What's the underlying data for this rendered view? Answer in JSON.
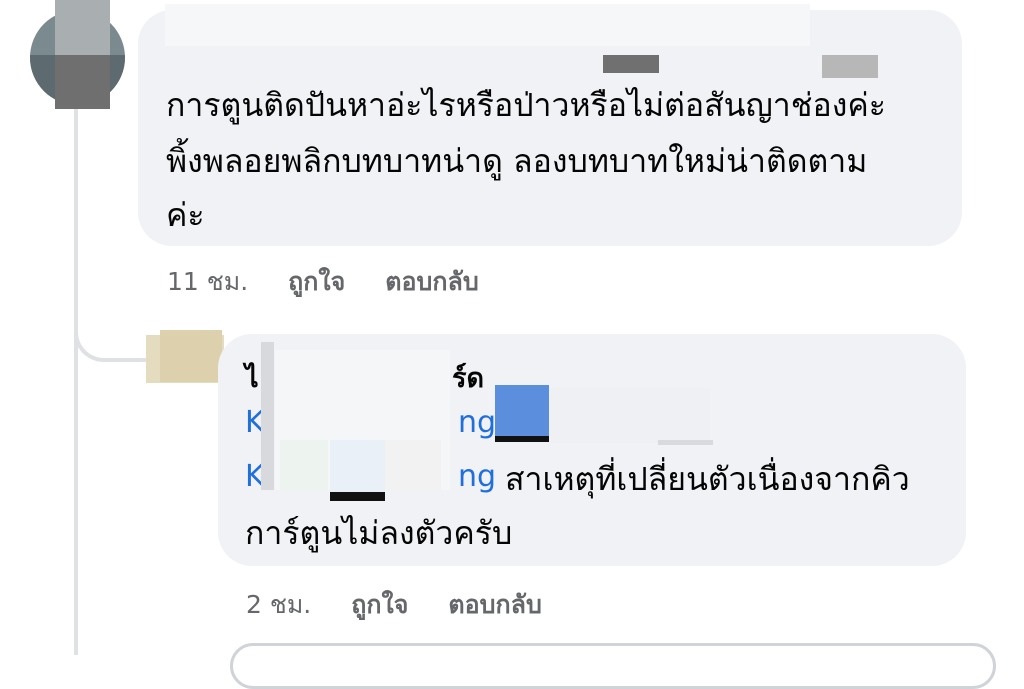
{
  "comment": {
    "author_visible": "",
    "text_line1": "การตูนติดปันหาอ่ะไรหรือป่าวหรือไม่ต่อสันญาช่องค่ะ",
    "text_line2": "พิ้งพลอยพลิกบทบาทน่าดู ลองบทบาทใหม่น่าติดตาม",
    "text_line3": "ค่ะ",
    "time": "11 ชม.",
    "like_label": "ถูกใจ",
    "reply_label": "ตอบกลับ"
  },
  "reply": {
    "author_start": "ไ",
    "author_end": "ร์ด",
    "mention1_start": "K",
    "mention1_end": "ng",
    "mention2_start": "K",
    "mention2_end": "ng",
    "text_after_mention": "สาเหตุที่เปลี่ยนตัวเนื่องจากคิว",
    "text_line2": "การ์ตูนไม่ลงตัวครับ",
    "time": "2 ชม.",
    "like_label": "ถูกใจ",
    "reply_label": "ตอบกลับ"
  },
  "colors": {
    "bubble": "#f0f2f5",
    "link": "#216fdb",
    "meta": "#65676b",
    "thread_line": "#dfe1e5"
  }
}
